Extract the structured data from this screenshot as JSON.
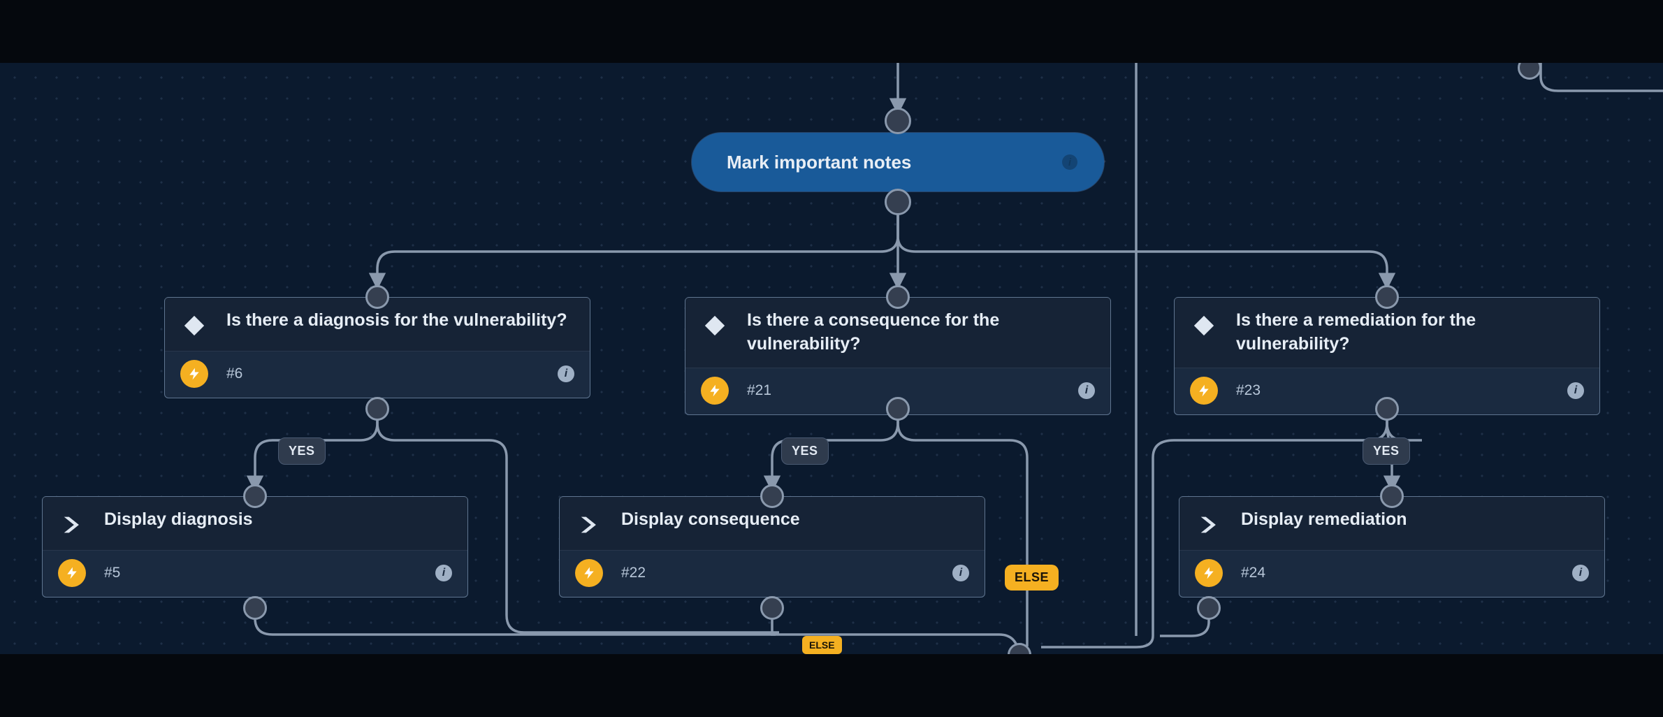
{
  "root": {
    "label": "Mark important notes"
  },
  "decisions": [
    {
      "title": "Is there a diagnosis for the vulnerability?",
      "id": "#6"
    },
    {
      "title": "Is there a consequence for the vulnerability?",
      "id": "#21"
    },
    {
      "title": "Is there a remediation for the vulnerability?",
      "id": "#23"
    }
  ],
  "actions": [
    {
      "title": "Display diagnosis",
      "id": "#5"
    },
    {
      "title": "Display consequence",
      "id": "#22"
    },
    {
      "title": "Display remediation",
      "id": "#24"
    }
  ],
  "badges": {
    "yes": "YES",
    "else": "ELSE"
  }
}
